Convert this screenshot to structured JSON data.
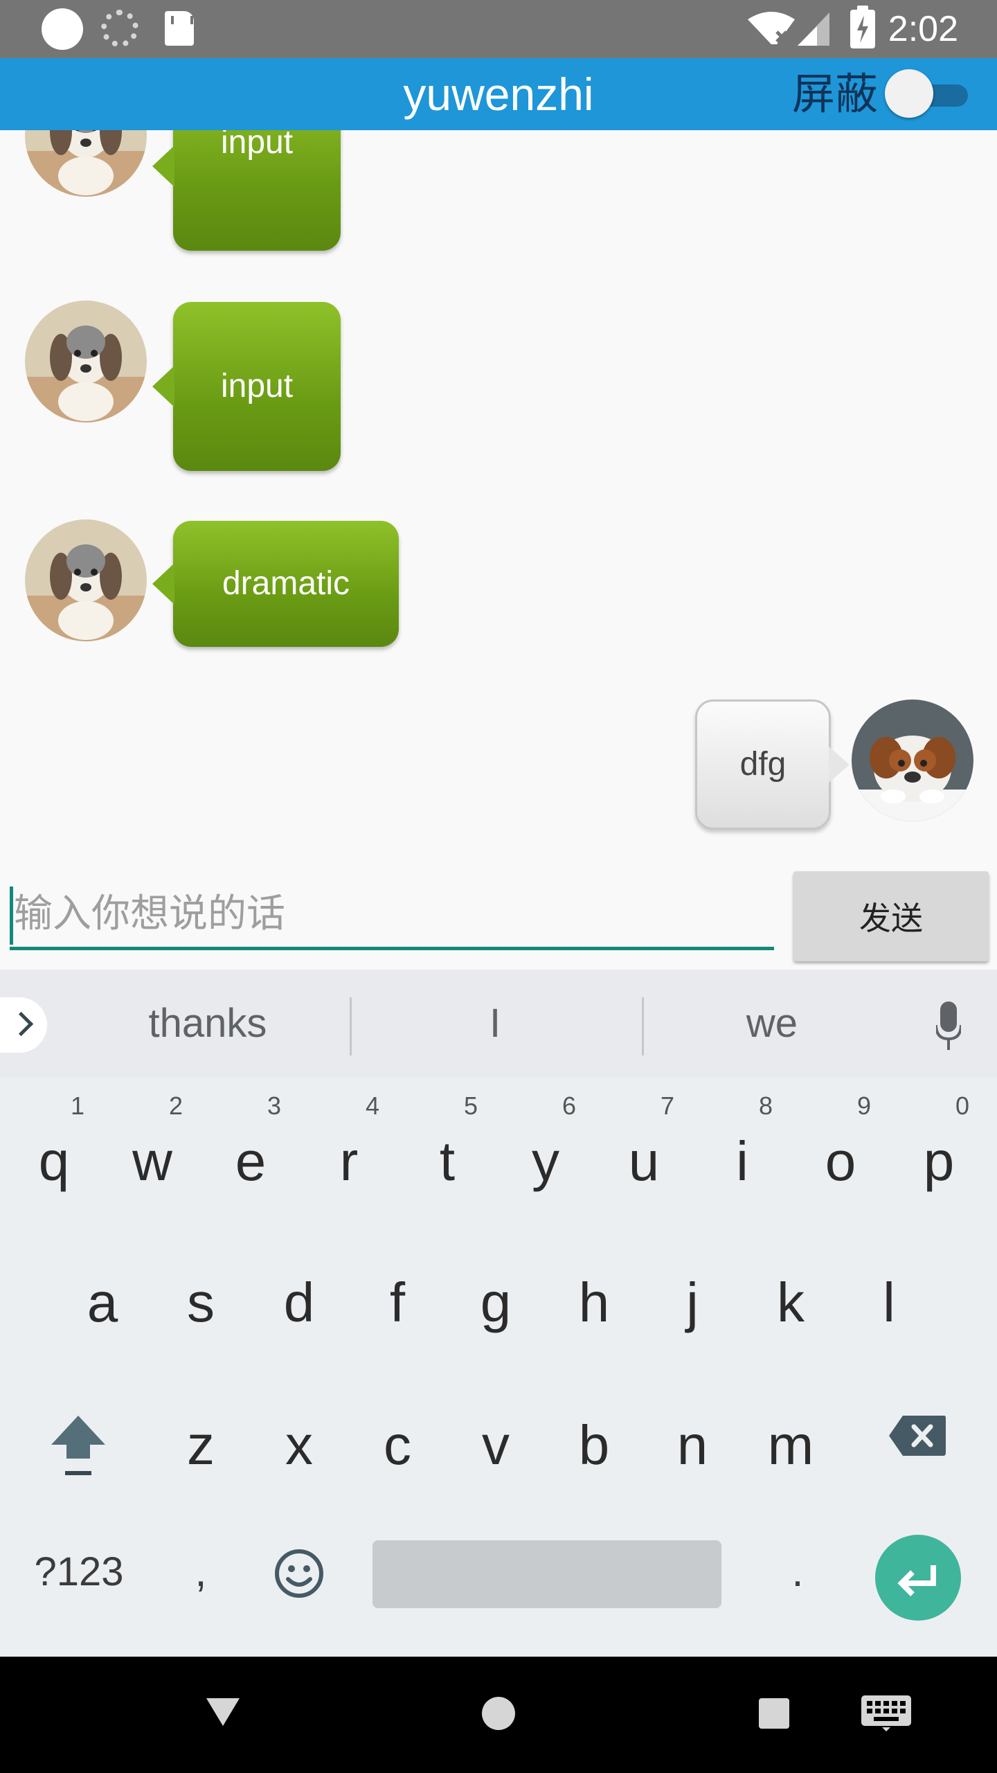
{
  "status_bar": {
    "time": "2:02",
    "icons": [
      "circle-notification-icon",
      "loading-ring-icon",
      "sd-card-icon",
      "wifi-off-icon",
      "signal-icon",
      "battery-charging-icon"
    ]
  },
  "app_bar": {
    "title": "yuwenzhi",
    "block_label": "屏蔽",
    "block_toggle_on": false
  },
  "messages": [
    {
      "side": "left",
      "text": "input",
      "avatar": "beagle-puppy-avatar"
    },
    {
      "side": "left",
      "text": "input",
      "avatar": "beagle-puppy-avatar"
    },
    {
      "side": "left",
      "text": "dramatic",
      "avatar": "beagle-puppy-avatar"
    },
    {
      "side": "right",
      "text": "dfg",
      "avatar": "bulldog-puppy-avatar"
    }
  ],
  "input_bar": {
    "placeholder": "输入你想说的话",
    "value": "",
    "send_label": "发送"
  },
  "keyboard": {
    "suggestions": [
      "thanks",
      "I",
      "we"
    ],
    "row1": [
      {
        "ch": "q",
        "hint": "1"
      },
      {
        "ch": "w",
        "hint": "2"
      },
      {
        "ch": "e",
        "hint": "3"
      },
      {
        "ch": "r",
        "hint": "4"
      },
      {
        "ch": "t",
        "hint": "5"
      },
      {
        "ch": "y",
        "hint": "6"
      },
      {
        "ch": "u",
        "hint": "7"
      },
      {
        "ch": "i",
        "hint": "8"
      },
      {
        "ch": "o",
        "hint": "9"
      },
      {
        "ch": "p",
        "hint": "0"
      }
    ],
    "row2": [
      "a",
      "s",
      "d",
      "f",
      "g",
      "h",
      "j",
      "k",
      "l"
    ],
    "row3": [
      "z",
      "x",
      "c",
      "v",
      "b",
      "n",
      "m"
    ],
    "symbols_label": "?123",
    "comma": ",",
    "period": ".",
    "accent_color": "#3fb59b"
  },
  "colors": {
    "app_bar": "#1e96d8",
    "status_bar": "#757575",
    "bubble_green": "#7aad1e",
    "input_underline": "#13897c"
  }
}
